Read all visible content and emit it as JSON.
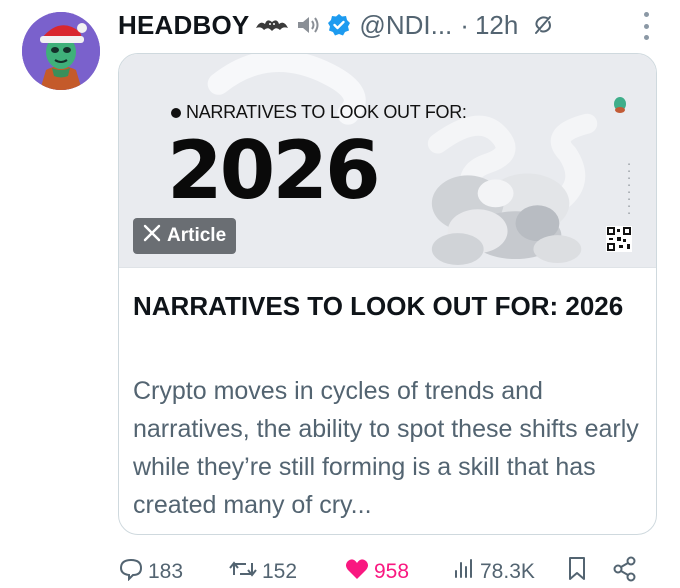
{
  "post": {
    "author_name": "HEADBOY",
    "handle": "@NDI...",
    "separator": "·",
    "time": "12h",
    "icons": [
      "bat-emoji",
      "speaker-icon",
      "verified-badge-icon",
      "grok-icon",
      "more-icon"
    ]
  },
  "article": {
    "banner_subtitle": "NARRATIVES TO LOOK OUT FOR:",
    "banner_year": "2026",
    "badge_label": "Article",
    "badge_icon": "x-logo-icon",
    "title": "NARRATIVES TO LOOK OUT FOR: 2026",
    "description": "Crypto moves in cycles of trends and narratives, the ability to spot these shifts early while they’re still forming is a skill that has created many of cry..."
  },
  "actions": {
    "replies": "183",
    "reposts": "152",
    "likes": "958",
    "views": "78.3K"
  },
  "colors": {
    "text_primary": "#0f1419",
    "text_secondary": "#536471",
    "like_pink": "#f91880",
    "verified_blue": "#1d9bf0",
    "border": "#cfd9de"
  }
}
